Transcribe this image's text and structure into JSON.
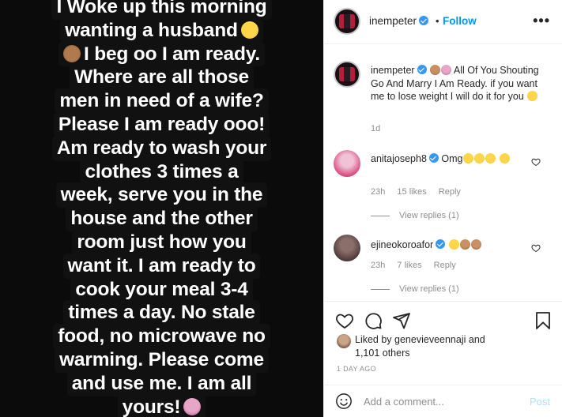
{
  "media": {
    "caption_lines": [
      "I Woke up this morning",
      "wanting a husband",
      "I beg oo I am ready.",
      "Where are all those",
      "men in need of a wife?",
      "Please I am ready ooo!",
      "Am ready to wash your",
      "clothes 3 times a",
      "week, serve you in the",
      "house and the other",
      "room just how you",
      "want it. I am ready to",
      "cook your meal 3-4",
      "times a day. No stale",
      "food, no microwave no",
      "warming. Please come",
      "and use me. I am all",
      "yours!"
    ]
  },
  "header": {
    "username": "inempeter",
    "separator": "•",
    "follow_label": "Follow",
    "more_label": "•••"
  },
  "caption_comment": {
    "username": "inempeter",
    "text": "All Of You Shouting Go And Marry I Am Ready. if you want me to lose weight I will do it for you",
    "time": "1d"
  },
  "comments": [
    {
      "username": "anitajoseph8",
      "text": "Omg",
      "time": "23h",
      "likes": "15 likes",
      "reply_label": "Reply",
      "view_replies": "View replies (1)"
    },
    {
      "username": "ejineokoroafor",
      "text": "",
      "time": "23h",
      "likes": "7 likes",
      "reply_label": "Reply",
      "view_replies": "View replies (1)"
    }
  ],
  "likes": {
    "prefix": "Liked by ",
    "liked_user": "genevieveennaji",
    "suffix": " and",
    "others": "1,101 others"
  },
  "timestamp": "1 DAY AGO",
  "add_comment": {
    "placeholder": "Add a comment...",
    "post_label": "Post"
  },
  "colors": {
    "accent": "#0095f6",
    "post_disabled": "#b2dffc",
    "meta": "#8e8e8e",
    "verified": "#3897f0"
  },
  "icons": [
    "heart-icon",
    "comment-icon",
    "share-icon",
    "bookmark-icon",
    "smile-icon",
    "verified-icon",
    "more-icon"
  ]
}
